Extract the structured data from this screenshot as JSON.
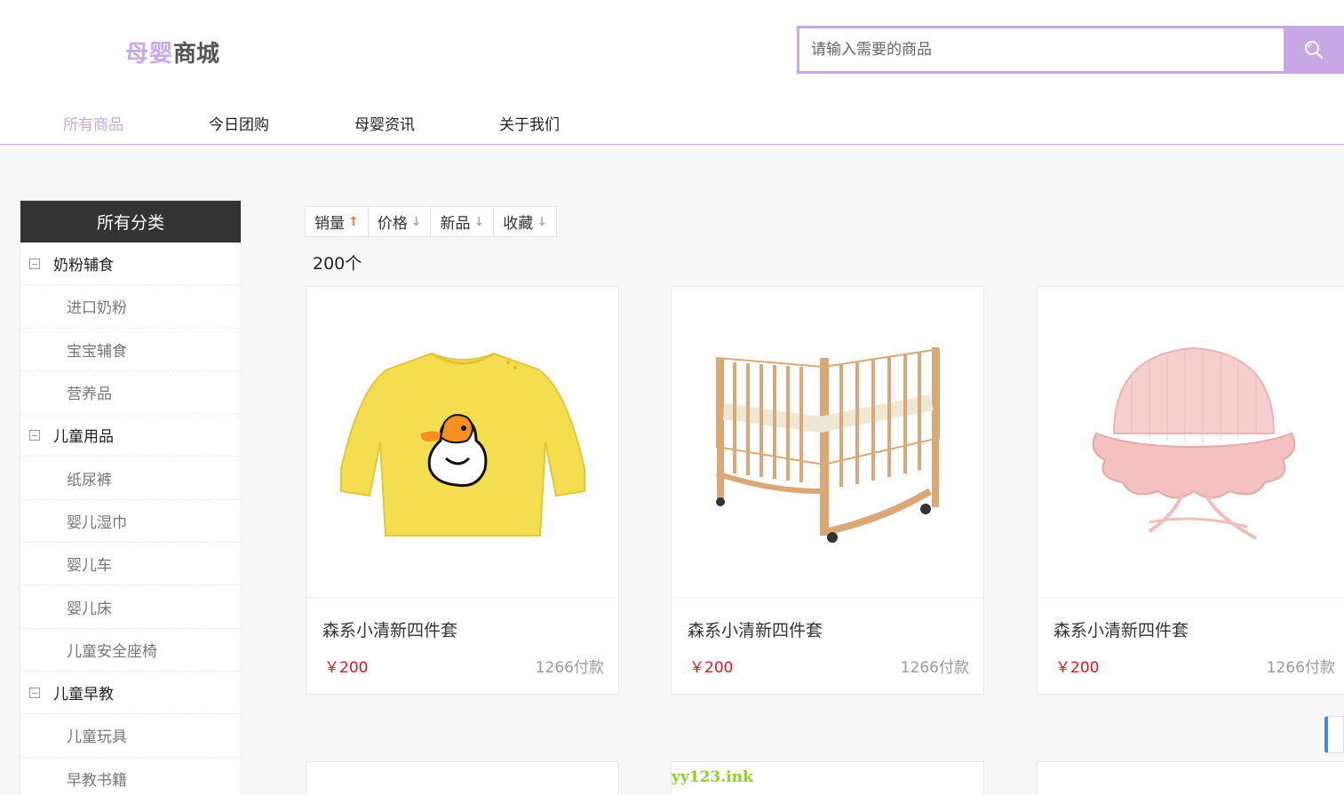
{
  "logo": {
    "part1": "母婴",
    "part2": "商城"
  },
  "search": {
    "placeholder": "请输入需要的商品"
  },
  "nav": [
    "所有商品",
    "今日团购",
    "母婴资讯",
    "关于我们"
  ],
  "sidebar": {
    "title": "所有分类",
    "groups": [
      {
        "label": "奶粉辅食",
        "items": [
          "进口奶粉",
          "宝宝辅食",
          "营养品"
        ]
      },
      {
        "label": "儿童用品",
        "items": [
          "纸尿裤",
          "婴儿湿巾",
          "婴儿车",
          "婴儿床",
          "儿童安全座椅"
        ]
      },
      {
        "label": "儿童早教",
        "items": [
          "儿童玩具",
          "早教书籍"
        ]
      }
    ]
  },
  "sort": [
    {
      "label": "销量",
      "direction": "up",
      "active": true
    },
    {
      "label": "价格",
      "direction": "down",
      "active": false
    },
    {
      "label": "新品",
      "direction": "down",
      "active": false
    },
    {
      "label": "收藏",
      "direction": "down",
      "active": false
    }
  ],
  "result_count": "200个",
  "products": [
    {
      "name": "森系小清新四件套",
      "price": "￥200",
      "sales": "1266付款",
      "image": "yellow-duck-shirt"
    },
    {
      "name": "森系小清新四件套",
      "price": "￥200",
      "sales": "1266付款",
      "image": "wooden-crib"
    },
    {
      "name": "森系小清新四件套",
      "price": "￥200",
      "sales": "1266付款",
      "image": "pink-knit-hat"
    }
  ],
  "watermark": "yy123.ink",
  "colors": {
    "accent": "#c9a8e6",
    "price": "#e4131b",
    "sort_active_arrow": "#ff6a1a",
    "sidebar_header": "#333333"
  }
}
